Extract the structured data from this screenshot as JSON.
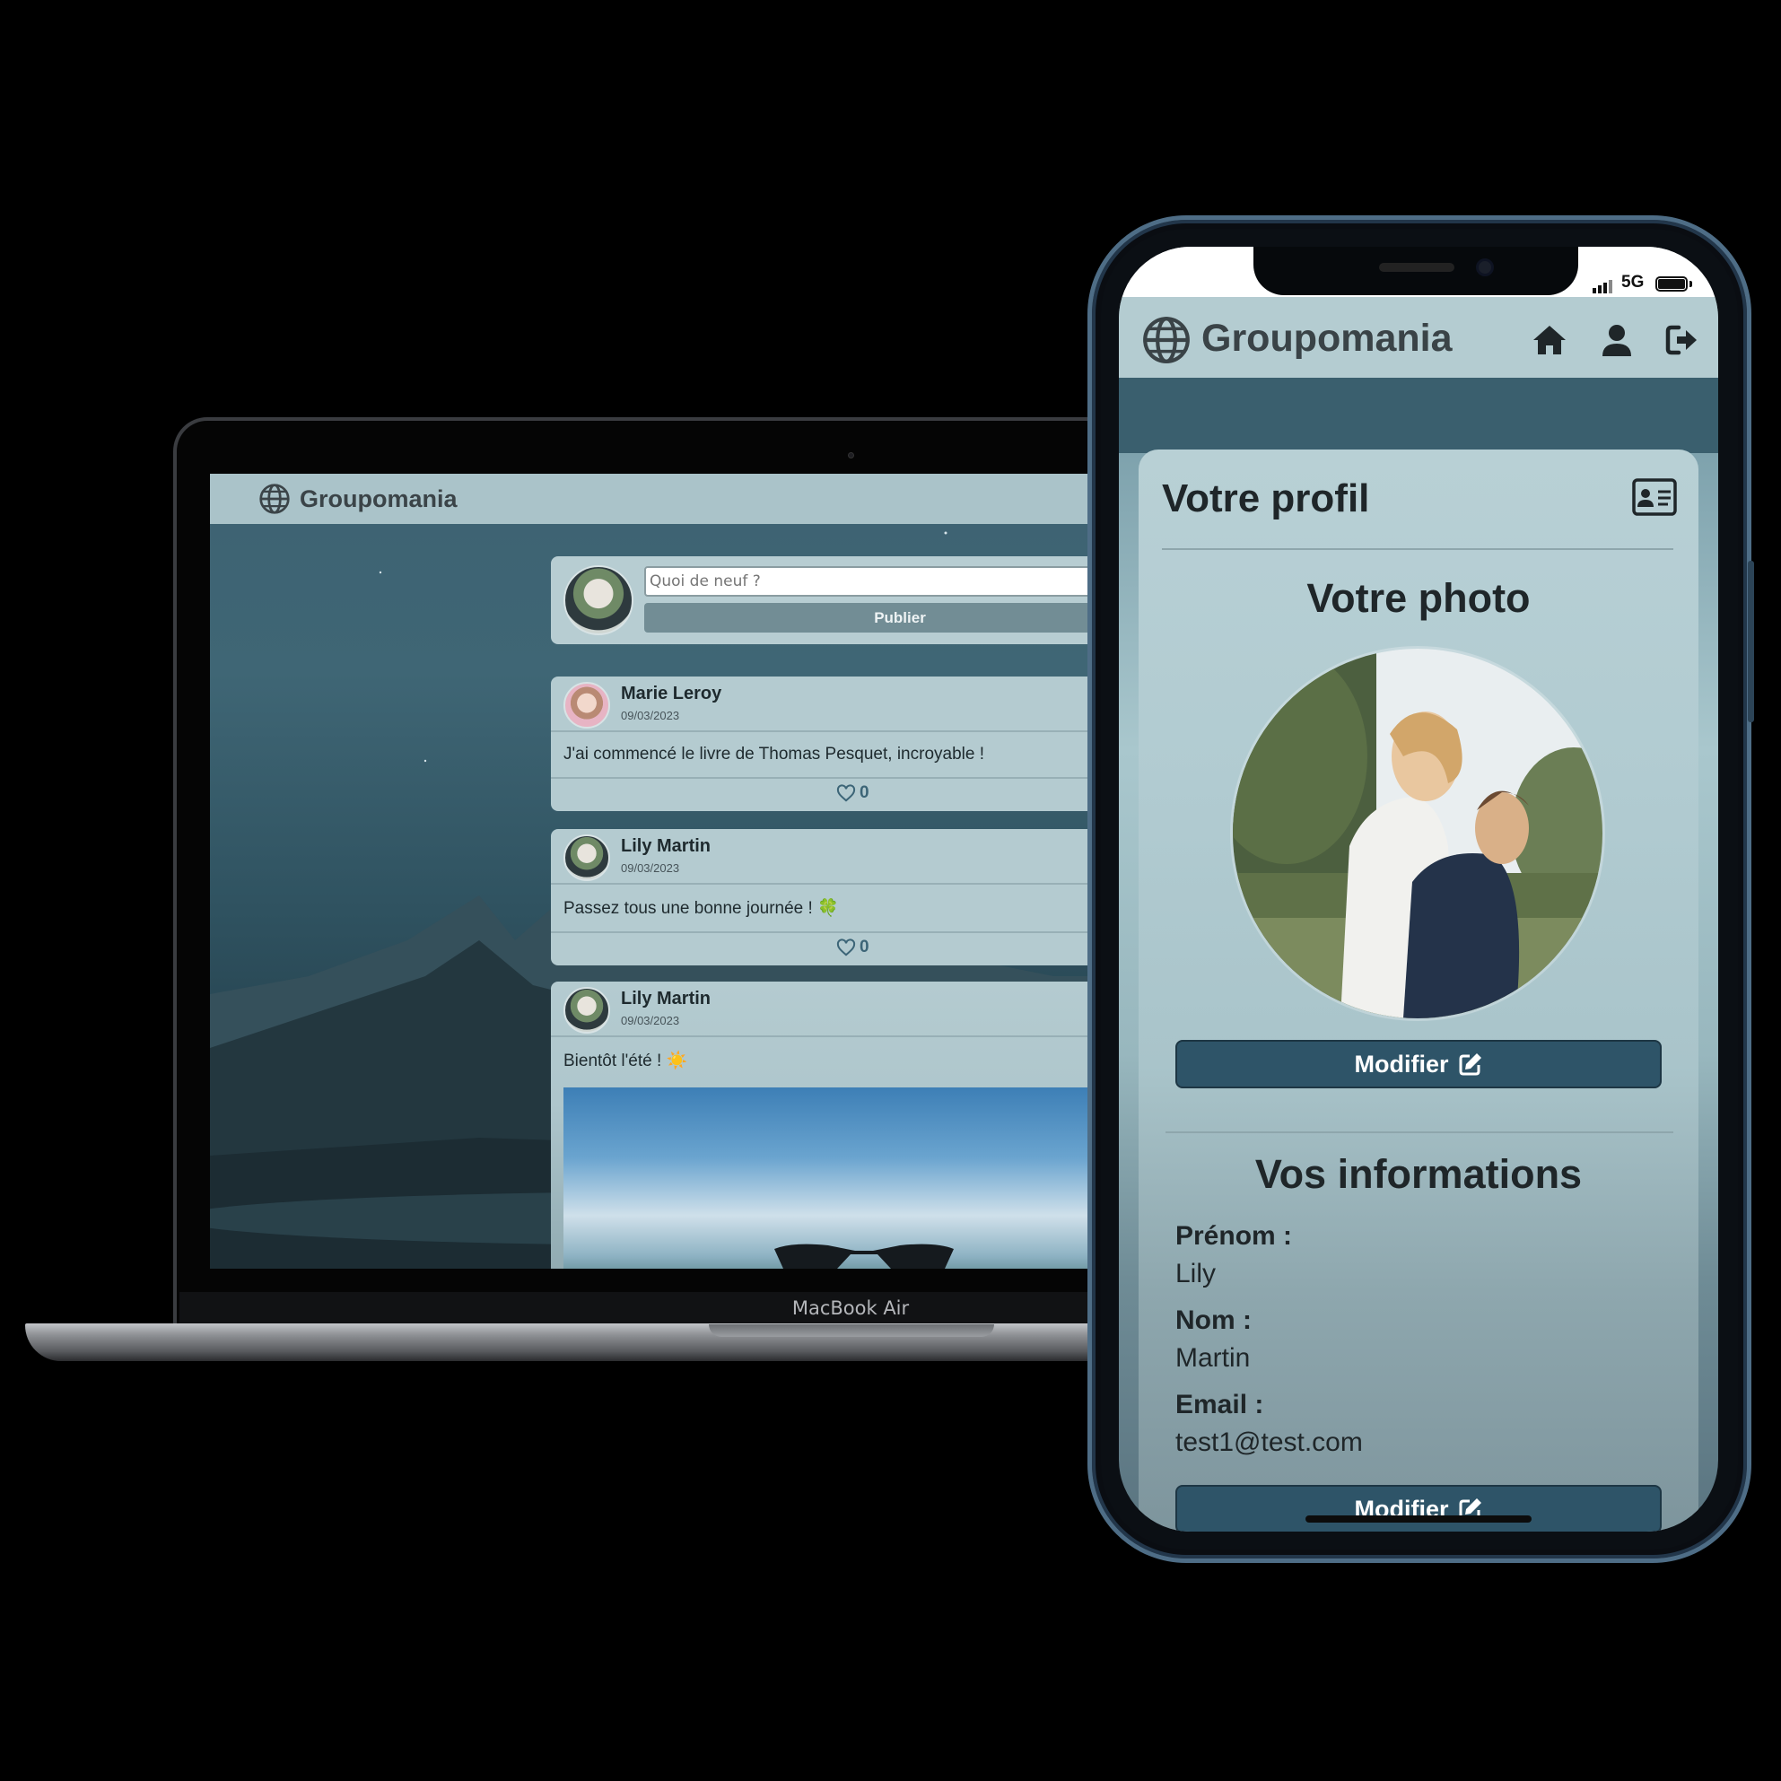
{
  "laptop": {
    "model_label": "MacBook Air",
    "app_name": "Groupomania",
    "composer": {
      "placeholder": "Quoi de neuf ?",
      "publish_label": "Publier"
    },
    "posts": [
      {
        "author": "Marie Leroy",
        "date": "09/03/2023",
        "text": "J'ai commencé le livre de Thomas Pesquet, incroyable !",
        "likes": "0"
      },
      {
        "author": "Lily Martin",
        "date": "09/03/2023",
        "text": "Passez tous une bonne journée ! 🍀",
        "likes": "0"
      },
      {
        "author": "Lily Martin",
        "date": "09/03/2023",
        "text": "Bientôt l'été ! ☀️"
      }
    ]
  },
  "phone": {
    "status": {
      "network": "5G"
    },
    "app_name": "Groupomania",
    "nav": [
      "home-icon",
      "user-icon",
      "logout-icon"
    ],
    "profile": {
      "title": "Votre profil",
      "photo_heading": "Votre photo",
      "modify_label": "Modifier",
      "info_heading": "Vos informations",
      "fields": [
        {
          "label": "Prénom :",
          "value": "Lily"
        },
        {
          "label": "Nom :",
          "value": "Martin"
        },
        {
          "label": "Email :",
          "value": "test1@test.com"
        }
      ],
      "modify_label_2": "Modifier"
    }
  }
}
